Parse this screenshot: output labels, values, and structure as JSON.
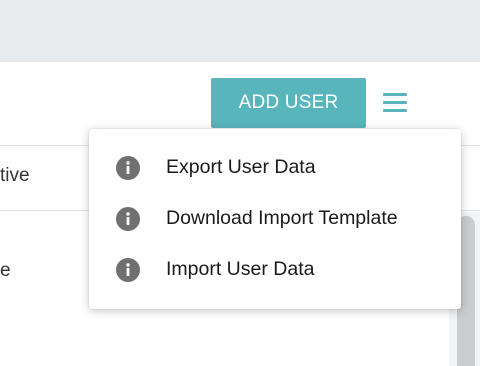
{
  "toolbar": {
    "add_user_label": "ADD USER",
    "menu_icon": "hamburger-menu-icon"
  },
  "table": {
    "header_partial": "tive",
    "row_partial": "e"
  },
  "menu": {
    "items": [
      {
        "label": "Export User Data",
        "icon": "info-icon"
      },
      {
        "label": "Download Import Template",
        "icon": "info-icon"
      },
      {
        "label": "Import User Data",
        "icon": "info-icon"
      }
    ]
  },
  "colors": {
    "accent": "#58b5bc",
    "icon_gray": "#707070",
    "top_band": "#e7ebee"
  }
}
